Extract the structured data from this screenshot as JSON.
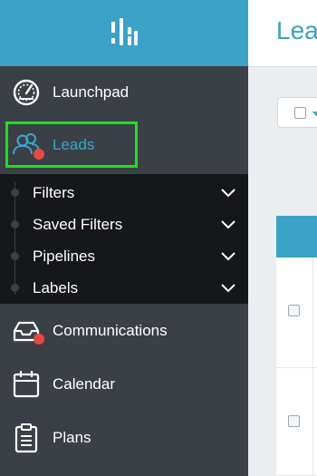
{
  "sidebar": {
    "logo_icon": "logo-bars-icon",
    "items": [
      {
        "label": "Launchpad",
        "icon": "gauge-icon"
      },
      {
        "label": "Leads",
        "icon": "users-icon",
        "badge": true,
        "active": true
      },
      {
        "label": "Communications",
        "icon": "inbox-icon",
        "badge": true
      },
      {
        "label": "Calendar",
        "icon": "calendar-icon"
      },
      {
        "label": "Plans",
        "icon": "clipboard-icon"
      }
    ],
    "submenu": [
      {
        "label": "Filters"
      },
      {
        "label": "Saved Filters"
      },
      {
        "label": "Pipelines"
      },
      {
        "label": "Labels"
      }
    ]
  },
  "main": {
    "page_title": "Lea"
  },
  "colors": {
    "brand": "#3aa2c4",
    "sidebar_bg": "#3b4046",
    "submenu_bg": "#15171a",
    "badge": "#e64a3e",
    "highlight": "#1ee11e"
  }
}
